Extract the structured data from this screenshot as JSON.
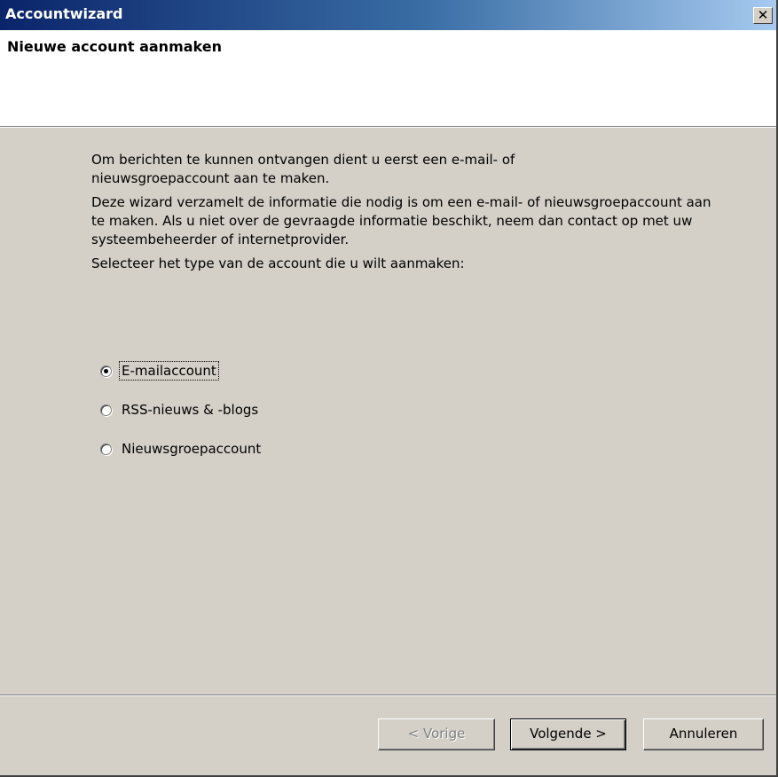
{
  "window": {
    "title": "Accountwizard",
    "close_label": "x"
  },
  "header": {
    "title": "Nieuwe account aanmaken"
  },
  "content": {
    "paragraph1": "Om berichten te kunnen ontvangen dient u eerst een e-mail- of nieuwsgroepaccount aan te maken.",
    "paragraph2": "Deze wizard verzamelt de informatie die nodig is om een e-mail- of nieuwsgroepaccount aan te maken. Als u niet over de gevraagde informatie beschikt, neem dan contact op met uw systeembeheerder of internetprovider.",
    "paragraph3": "Selecteer het type van de account die u wilt aanmaken:"
  },
  "account_types": [
    {
      "label": "E-mailaccount",
      "selected": true
    },
    {
      "label": "RSS-nieuws & -blogs",
      "selected": false
    },
    {
      "label": "Nieuwsgroepaccount",
      "selected": false
    }
  ],
  "buttons": {
    "prev_label": "< Vorige",
    "next_label": "Volgende >",
    "cancel_label": "Annuleren"
  }
}
